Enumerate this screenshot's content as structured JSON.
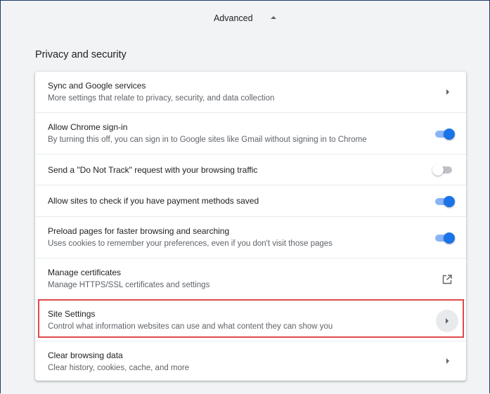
{
  "advanced": {
    "label": "Advanced",
    "icon": "caret-up-icon"
  },
  "section": {
    "title": "Privacy and security"
  },
  "rows": [
    {
      "title": "Sync and Google services",
      "subtitle": "More settings that relate to privacy, security, and data collection",
      "control": "arrow"
    },
    {
      "title": "Allow Chrome sign-in",
      "subtitle": "By turning this off, you can sign in to Google sites like Gmail without signing in to Chrome",
      "control": "toggle",
      "enabled": true
    },
    {
      "title": "Send a \"Do Not Track\" request with your browsing traffic",
      "subtitle": "",
      "control": "toggle",
      "enabled": false
    },
    {
      "title": "Allow sites to check if you have payment methods saved",
      "subtitle": "",
      "control": "toggle",
      "enabled": true
    },
    {
      "title": "Preload pages for faster browsing and searching",
      "subtitle": "Uses cookies to remember your preferences, even if you don't visit those pages",
      "control": "toggle",
      "enabled": true
    },
    {
      "title": "Manage certificates",
      "subtitle": "Manage HTTPS/SSL certificates and settings",
      "control": "external-link"
    },
    {
      "title": "Site Settings",
      "subtitle": "Control what information websites can use and what content they can show you",
      "control": "arrow-circle",
      "highlighted": true
    },
    {
      "title": "Clear browsing data",
      "subtitle": "Clear history, cookies, cache, and more",
      "control": "arrow"
    }
  ],
  "colors": {
    "accent": "#1a73e8",
    "highlight_border": "#e0484c",
    "background": "#f1f3f4"
  }
}
